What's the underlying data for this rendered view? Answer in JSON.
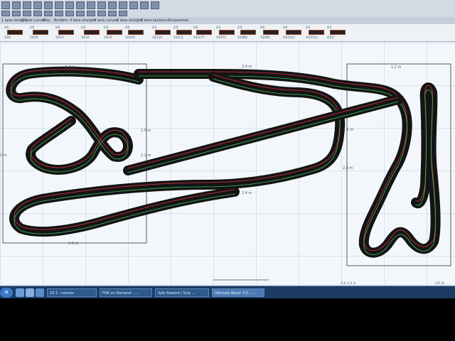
{
  "toolbar": {
    "row1_icons": [
      "new-icon",
      "open-icon",
      "save-icon",
      "print-icon",
      "cut-icon",
      "copy-icon",
      "paste-icon",
      "undo-icon",
      "redo-icon",
      "zoom-in-icon",
      "zoom-out-icon",
      "grid-icon",
      "measure-icon",
      "settings-icon",
      "help-icon"
    ],
    "row2_icons": [
      "select-icon",
      "rotate-icon",
      "flip-icon",
      "delete-icon",
      "group-icon",
      "ungroup-icon",
      "align-icon",
      "lane-icon",
      "track-icon",
      "border-icon",
      "layer-icon",
      "view-icon"
    ]
  },
  "tabs": [
    "1 lane straight",
    "2 lane curves",
    "Misc",
    "Borders",
    "4 lane straight",
    "4 lane curves",
    "6 lane straight",
    "6 lane sections",
    "Accessories"
  ],
  "palette": [
    {
      "code": "0/0",
      "num": "10/0"
    },
    {
      "code": "0/0",
      "num": "10/10"
    },
    {
      "code": "0/0",
      "num": "10/13"
    },
    {
      "code": "0/0",
      "num": "10/16"
    },
    {
      "code": "0/0",
      "num": "10/14"
    },
    {
      "code": "0/0",
      "num": "10/102"
    },
    {
      "code": "0/0",
      "num": "10/114"
    },
    {
      "code": "0/0",
      "num": "10/111"
    },
    {
      "code": "0/0",
      "num": "10/2/72"
    },
    {
      "code": "0/0",
      "num": "10/07C"
    },
    {
      "code": "0/0",
      "num": "10/08U"
    },
    {
      "code": "0/0",
      "num": "10/08C"
    },
    {
      "code": "0/0",
      "num": "40/21(L)"
    },
    {
      "code": "0/0",
      "num": "40/21(L)"
    },
    {
      "code": "0/0",
      "num": "4/22*"
    }
  ],
  "dimensions": {
    "top_length": "2.4 m",
    "right_length": "1.2 m",
    "left_height": "1.5 m",
    "center_height": "2.1 m",
    "mid_length": "2.4 m",
    "right_height": "1.5 m",
    "right_center": "2.4 m",
    "bottom_length": "1.8 m",
    "left_edge": "1 m",
    "top_left": "1.8 m"
  },
  "status": {
    "coords": "0.0  -0.3 m",
    "zoom": "125 %"
  },
  "taskbar": {
    "start_label": "",
    "items": [
      {
        "label": "10.1 - convex"
      },
      {
        "label": "FOX on Demand - ..."
      },
      {
        "label": "Syfy Rewind | Syfy ..."
      },
      {
        "label": "Ultimate Racer 3.0 - ..."
      }
    ]
  },
  "colors": {
    "track": "#141414",
    "lane_red": "#e03040",
    "lane_green": "#40c060",
    "grid": "#9fc4e0",
    "taskbar": "#1c3c64"
  }
}
